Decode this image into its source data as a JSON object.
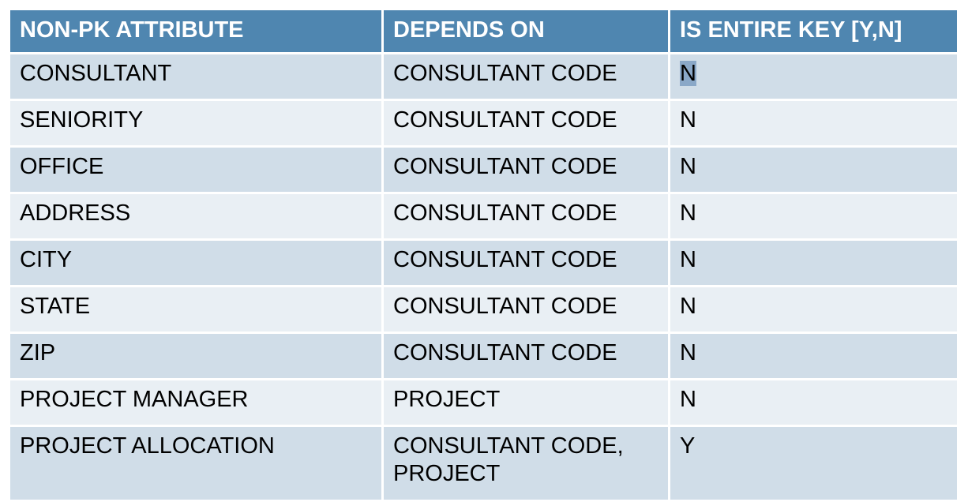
{
  "table": {
    "headers": [
      "NON-PK ATTRIBUTE",
      "DEPENDS ON",
      "IS ENTIRE KEY [Y,N]"
    ],
    "rows": [
      [
        "CONSULTANT",
        "CONSULTANT CODE",
        "N"
      ],
      [
        "SENIORITY",
        "CONSULTANT CODE",
        "N"
      ],
      [
        "OFFICE",
        "CONSULTANT CODE",
        "N"
      ],
      [
        "ADDRESS",
        "CONSULTANT CODE",
        "N"
      ],
      [
        "CITY",
        "CONSULTANT CODE",
        "N"
      ],
      [
        "STATE",
        "CONSULTANT CODE",
        "N"
      ],
      [
        "ZIP",
        "CONSULTANT CODE",
        "N"
      ],
      [
        "PROJECT MANAGER",
        "PROJECT",
        "N"
      ],
      [
        "PROJECT ALLOCATION",
        "CONSULTANT CODE,",
        "Y"
      ]
    ],
    "last_row_depends_line2": "PROJECT"
  },
  "colors": {
    "header_bg": "#4f86b0",
    "row_odd_bg": "#d0dde8",
    "row_even_bg": "#e9eff4",
    "selection_highlight": "#8aa8c8"
  }
}
